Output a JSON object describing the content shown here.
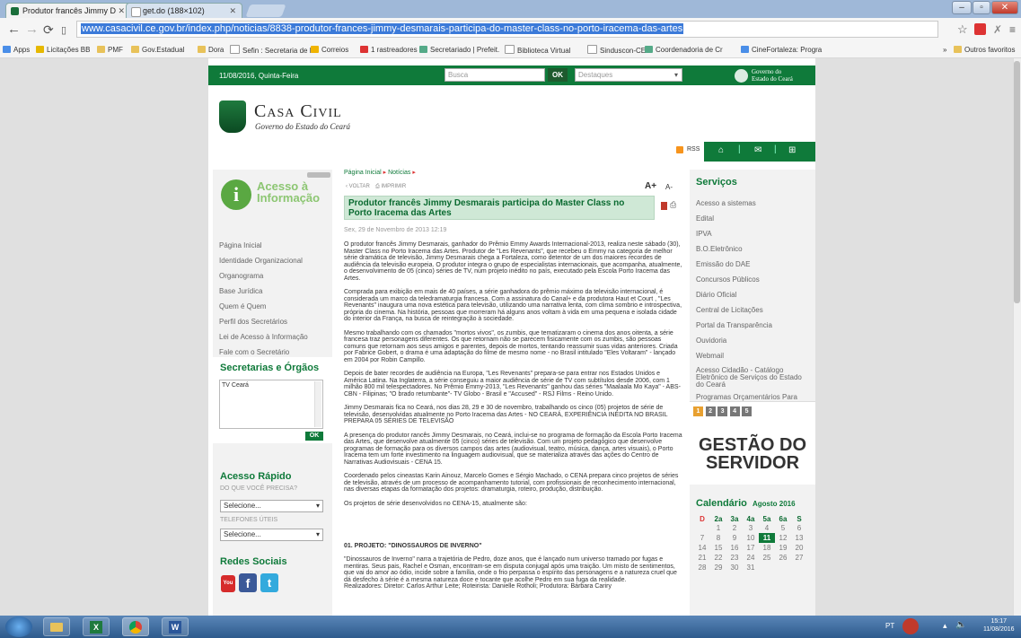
{
  "browser": {
    "tabs": [
      {
        "title": "Produtor francês Jimmy D",
        "active": true
      },
      {
        "title": "get.do (188×102)",
        "active": false
      }
    ],
    "url_prefix": "www.casacivil.ce.gov.br",
    "url_rest": "/index.php/noticias/8838-produtor-frances-jimmy-desmarais-participa-do-master-class-no-porto-iracema-das-artes",
    "bookmarks": [
      "Apps",
      "Licitações BB",
      "PMF",
      "Gov.Estadual",
      "Dora",
      "Sefin : Secretaria de F",
      "Correios",
      "1 rastreadores",
      "Secretariado | Prefeit.",
      "Biblioteca Virtual",
      "Sinduscon-CE",
      "Coordenadoria de Cr",
      "CineFortaleza: Progra",
      "»",
      "Outros favoritos"
    ]
  },
  "site": {
    "date": "11/08/2016, Quinta-Feira",
    "search_placeholder": "Busca",
    "ok_label": "OK",
    "destaques_label": "Destaques",
    "gov_logo_line1": "Governo do",
    "gov_logo_line2": "Estado do Ceará",
    "brand_title": "Casa Civil",
    "brand_subtitle": "Governo do Estado do Ceará",
    "rss_label": "RSS",
    "acesso_title_1": "Acesso à",
    "acesso_title_2": "Informação",
    "left_menu": [
      "Página Inicial",
      "Identidade Organizacional",
      "Organograma",
      "Base Jurídica",
      "Quem é Quem",
      "Perfil dos Secretários",
      "Lei de Acesso à Informação",
      "Fale com o Secretário"
    ],
    "secretarias_title": "Secretarias e Órgãos",
    "secretarias_selected": "TV Ceará",
    "acesso_rapido_title": "Acesso Rápido",
    "acesso_rapido_sub": "DO QUE VOCÊ PRECISA?",
    "select_placeholder": "Selecione...",
    "telefones_label": "TELEFONES ÚTEIS",
    "redes_title": "Redes Sociais"
  },
  "article": {
    "breadcrumb_home": "Página Inicial",
    "breadcrumb_section": "Notícias",
    "voltar": "VOLTAR",
    "imprimir": "IMPRIMIR",
    "font_up": "A+",
    "font_down": "A-",
    "title": "Produtor francês Jimmy Desmarais participa do Master Class no Porto Iracema das Artes",
    "date": "Sex, 29 de Novembro de 2013 12:19",
    "paragraphs": [
      "O produtor francês Jimmy Desmarais, ganhador do Prêmio Emmy Awards Internacional-2013, realiza neste sábado (30), Master Class no Porto Iracema das Artes. Produtor de \"Les Revenants\", que recebeu o Emmy na categoria de melhor série dramática de televisão, Jimmy Desmarais chega a Fortaleza, como detentor de um dos maiores recordes de audiência da televisão europeia. O produtor integra o grupo de especialistas internacionais, que acompanha, atualmente, o desenvolvimento de 05 (cinco) séries de TV, num projeto inédito no país, executado pela Escola Porto Iracema das Artes.",
      "Comprada para exibição em mais de 40 países, a série ganhadora do prêmio máximo da televisão internacional, é considerada um marco da teledramaturgia francesa. Com a assinatura do Canal+ e da produtora Haut et Court , \"Les Revenants\" inaugura uma nova estética para televisão, utilizando uma narrativa lenta, com clima sombrio e introspectiva, própria do cinema. Na história, pessoas que morreram há alguns anos voltam à vida em uma pequena e isolada cidade do interior da França, na busca de reintegração à sociedade.",
      "Mesmo trabalhando com os chamados \"mortos vivos\", os zumbis, que tematizaram o cinema dos anos oitenta, a série francesa traz personagens diferentes. Os que retornam não se parecem fisicamente com os zumbis, são pessoas comuns que retornam aos seus amigos e parentes, depois de mortos, tentando reassumir suas vidas anteriores. Criada por Fabrice Gobert, o drama é uma adaptação do filme de mesmo nome - no Brasil intitulado \"Eles Voltaram\" - lançado em 2004 por Robin Campillo.",
      "Depois de bater recordes de audiência na Europa, \"Les Revenants\" prepara-se para entrar nos Estados Unidos e América Latina. Na Inglaterra, a série conseguiu a maior audiência de série de TV com subtítulos desde 2006, com 1 milhão 800 mil telespectadores. No Prêmio Emmy-2013, \"Les Revenants\" ganhou das séries \"Maalaala Mo Kaya\" - ABS-CBN - Filipinas; \"O brado retumbante\"- TV Globo - Brasil e \"Accused\" - RSJ Films - Reino Unido.",
      "Jimmy Desmarais fica no Ceará, nos dias 28, 29 e 30 de novembro, trabalhando os cinco (05) projetos de série de televisão, desenvolvidas atualmente no Porto Iracema das Artes - NO CEARÁ, EXPERIÊNCIA INÉDITA NO BRASIL PREPARA 05 SÉRIES DE TELEVISÃO",
      "A presença do produtor rancês Jimmy Desmarais, no Ceará, inclui-se no programa de formação da Escola Porto Iracema das Artes, que desenvolve atualmente 05 (cinco) séries de televisão. Com um projeto pedagógico que desenvolve programas de formação para os diversos campos das artes (audiovisual, teatro, música, dança, artes visuais), o Porto Iracema tem um forte investimento na linguagem audiovisual, que se materializa através das ações do Centro de Narrativas Audiovisuais - CENA 15.",
      "Coordenado pelos cineastas Karin Ainouz, Marcelo Gomes e Sérgio Machado, o CENA prepara cinco projetos de séries de televisão, através de um processo de acompanhamento tutorial, com profissionais de reconhecimento internacional, nas diversas etapas da formatação dos projetos: dramaturgia, roteiro, produção, distribuição.",
      "Os projetos de série desenvolvidos no CENA-15, atualmente são:"
    ],
    "project_heading": "01. PROJETO: \"DINOSSAUROS DE INVERNO\"",
    "project_text": "\"Dinossauros de Inverno\" narra a trajetória de Pedro, doze anos, que é lançado num universo tramado por fugas e mentiras. Seus pais, Rachel e Osman, encontram-se em disputa conjugal após uma traição. Um misto de sentimentos, que vai do amor ao ódio, incide sobre a família, onde o frio perpassa o espírito das personagens e a natureza cruel que dá desfecho à série é a mesma natureza doce e tocante que acolhe Pedro em sua fuga da realidade.",
    "project_credits": "Realizadores: Diretor: Carlos Arthur Leite; Roteirista: Danielle Rotholi; Produtora: Bárbara Cariry"
  },
  "services": {
    "title": "Serviços",
    "items": [
      "Acesso a sistemas",
      "Edital",
      "IPVA",
      "B.O.Eletrônico",
      "Emissão do DAE",
      "Concursos Públicos",
      "Diário Oficial",
      "Central de Licitações",
      "Portal da Transparência",
      "Ouvidoria",
      "Webmail",
      "Acesso Cidadão - Catálogo Eletrônico de Serviços do Estado do Ceará",
      "Programas Orçamentários Para Execução de Parcerias"
    ],
    "banner_pages": [
      "1",
      "2",
      "3",
      "4",
      "5"
    ],
    "banner_line1": "GESTÃO DO",
    "banner_line2": "SERVIDOR",
    "calendar_title": "Calendário",
    "calendar_month": "Agosto 2016",
    "weekdays": [
      "D",
      "2a",
      "3a",
      "4a",
      "5a",
      "6a",
      "S"
    ],
    "weeks": [
      [
        "",
        "1",
        "2",
        "3",
        "4",
        "5",
        "6"
      ],
      [
        "7",
        "8",
        "9",
        "10",
        "11",
        "12",
        "13"
      ],
      [
        "14",
        "15",
        "16",
        "17",
        "18",
        "19",
        "20"
      ],
      [
        "21",
        "22",
        "23",
        "24",
        "25",
        "26",
        "27"
      ],
      [
        "28",
        "29",
        "30",
        "31",
        "",
        "",
        ""
      ]
    ],
    "today": "11"
  },
  "taskbar": {
    "lang": "PT",
    "time": "15:17",
    "date": "11/08/2016"
  },
  "colors": {
    "site_green": "#0f7a3a",
    "title_bg": "#cfe8d6",
    "title_text": "#0a6a30",
    "url_selection": "#3b7ad9"
  }
}
